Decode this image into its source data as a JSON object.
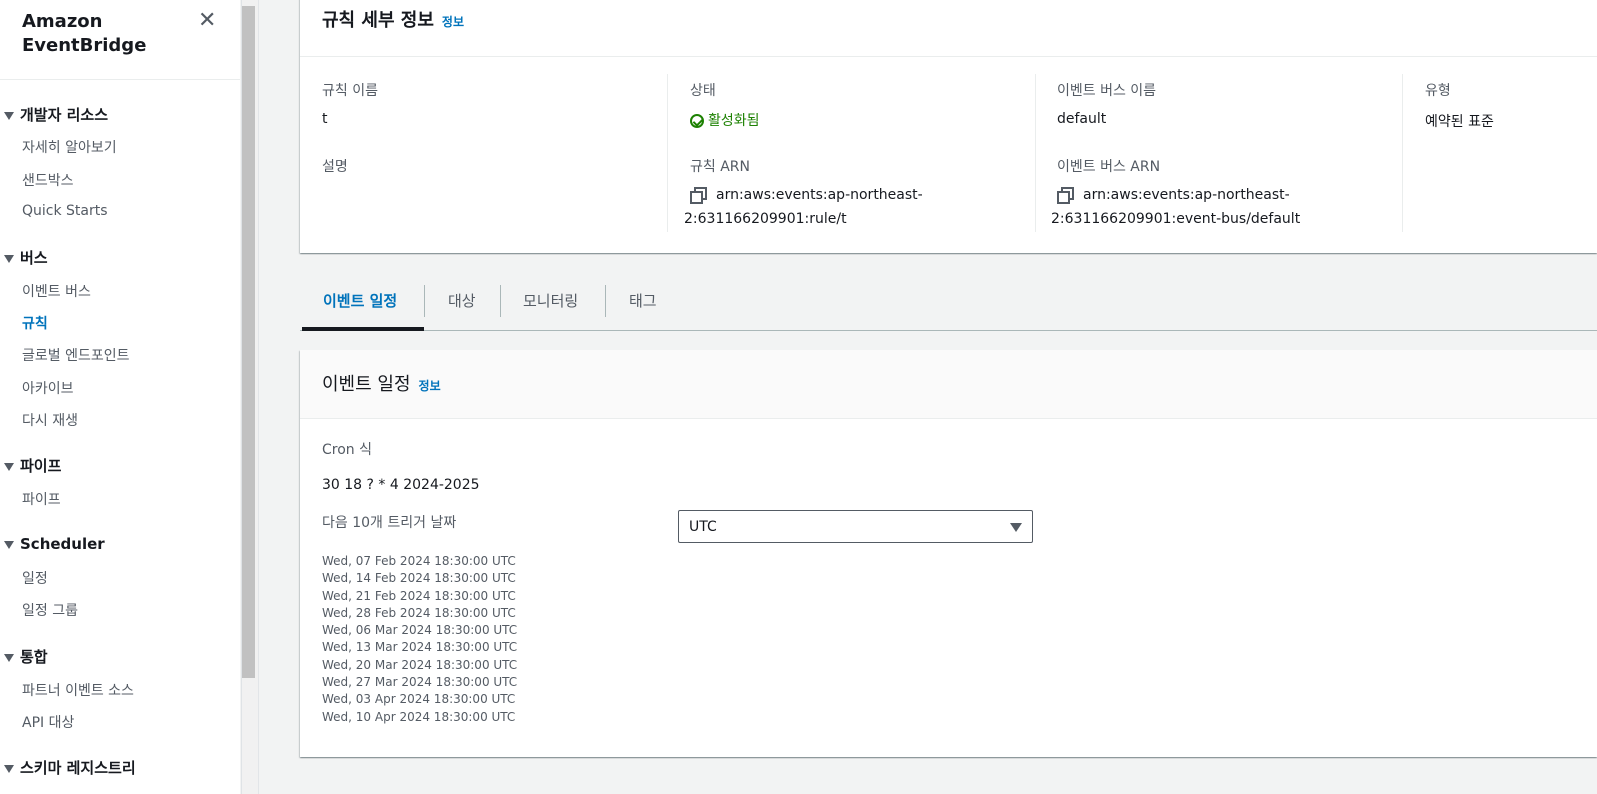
{
  "sidebar": {
    "brand_line1": "Amazon",
    "brand_line2": "EventBridge",
    "close_icon": "close-icon",
    "sections": [
      {
        "label": "개발자 리소스",
        "items": [
          "자세히 알아보기",
          "샌드박스",
          "Quick Starts"
        ]
      },
      {
        "label": "버스",
        "items": [
          "이벤트 버스",
          "규칙",
          "글로벌 엔드포인트",
          "아카이브",
          "다시 재생"
        ]
      },
      {
        "label": "파이프",
        "items": [
          "파이프"
        ]
      },
      {
        "label": "Scheduler",
        "items": [
          "일정",
          "일정 그룹"
        ]
      },
      {
        "label": "통합",
        "items": [
          "파트너 이벤트 소스",
          "API 대상"
        ]
      },
      {
        "label": "스키마 레지스트리",
        "items": []
      }
    ],
    "active_item": "규칙"
  },
  "rule_details": {
    "title": "규칙 세부 정보",
    "info": "정보",
    "rule_name_label": "규칙 이름",
    "rule_name": "t",
    "description_label": "설명",
    "status_label": "상태",
    "status": "활성화됨",
    "rule_arn_label": "규칙 ARN",
    "rule_arn": "arn:aws:events:ap-northeast-2:631166209901:rule/t",
    "bus_name_label": "이벤트 버스 이름",
    "bus_name": "default",
    "bus_arn_label": "이벤트 버스 ARN",
    "bus_arn": "arn:aws:events:ap-northeast-2:631166209901:event-bus/default",
    "type_label": "유형",
    "type": "예약된 표준"
  },
  "tabs": [
    "이벤트 일정",
    "대상",
    "모니터링",
    "태그"
  ],
  "active_tab": "이벤트 일정",
  "schedule": {
    "title": "이벤트 일정",
    "info": "정보",
    "cron_label": "Cron 식",
    "cron": "30 18 ? * 4 2024-2025",
    "next_label": "다음 10개 트리거 날짜",
    "timezone": "UTC",
    "dates": [
      "Wed, 07 Feb 2024 18:30:00 UTC",
      "Wed, 14 Feb 2024 18:30:00 UTC",
      "Wed, 21 Feb 2024 18:30:00 UTC",
      "Wed, 28 Feb 2024 18:30:00 UTC",
      "Wed, 06 Mar 2024 18:30:00 UTC",
      "Wed, 13 Mar 2024 18:30:00 UTC",
      "Wed, 20 Mar 2024 18:30:00 UTC",
      "Wed, 27 Mar 2024 18:30:00 UTC",
      "Wed, 03 Apr 2024 18:30:00 UTC",
      "Wed, 10 Apr 2024 18:30:00 UTC"
    ]
  },
  "colors": {
    "accent": "#0073bb",
    "success": "#1d8102"
  }
}
